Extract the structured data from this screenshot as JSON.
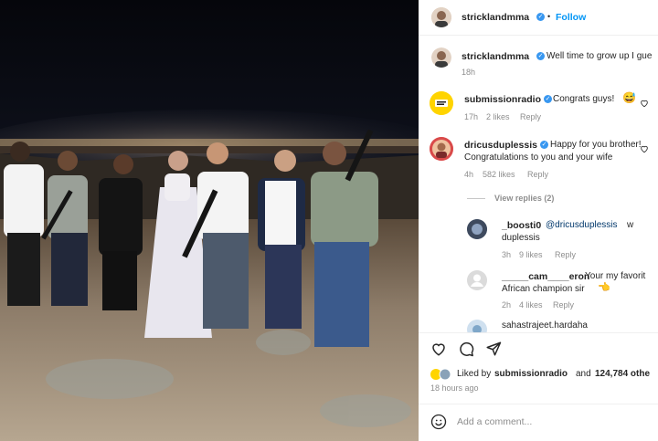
{
  "post": {
    "author": "stricklandmma",
    "follow_label": "Follow",
    "image_icon": "wedding-photo-desert-night"
  },
  "caption": {
    "author": "stricklandmma",
    "text": "Well time to grow up I gue",
    "time": "18h"
  },
  "comments": [
    {
      "author": "submissionradio",
      "text": "Congrats guys!",
      "emoji_icon": "sweat-smile-emoji",
      "time": "17h",
      "likes": "2 likes",
      "reply": "Reply"
    },
    {
      "author": "dricusduplessis",
      "text": "Happy for you brother!",
      "text2": "Congratulations to you and your wife",
      "time": "4h",
      "likes": "582 likes",
      "reply": "Reply",
      "view_replies": "View replies (2)",
      "replies": [
        {
          "author": "_boosti0",
          "mention": "@dricusduplessis",
          "text": "w",
          "text2": "duplessis",
          "time": "3h",
          "likes": "9 likes",
          "reply": "Reply"
        },
        {
          "author": "_____cam____eron",
          "text": "Your my favorit",
          "text2": "African champion sir",
          "emoji_icon": "hand-emoji",
          "time": "2h",
          "likes": "4 likes",
          "reply": "Reply"
        },
        {
          "author": "sahastrajeet.hardaha"
        }
      ]
    }
  ],
  "likes_line": {
    "prefix": "Liked by",
    "user": "submissionradio",
    "mid": "and",
    "count": "124,784 othe"
  },
  "timestamp": "18 hours ago",
  "add_comment_placeholder": "Add a comment...",
  "colors": {
    "accent": "#0095f6",
    "verified": "#3897f0",
    "muted": "#8e8e8e"
  }
}
